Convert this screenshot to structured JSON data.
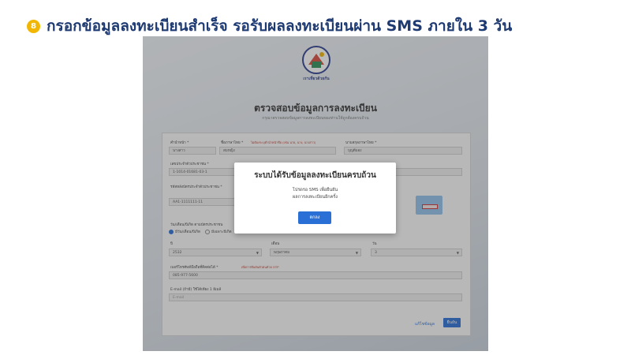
{
  "header": {
    "step_number": "8",
    "title": "กรอกข้อมูลลงทะเบียนสำเร็จ รอรับผลลงทะเบียนผ่าน SMS ภายใน 3 วัน"
  },
  "brand": {
    "logo_text": "เราเที่ยวด้วยกัน"
  },
  "form": {
    "title": "ตรวจสอบข้อมูลการลงทะเบียน",
    "subtitle": "กรุณาตรวจสอบข้อมูลการลงทะเบียนของท่านให้ถูกต้องครบถ้วน",
    "prefix_label": "คำนำหน้า *",
    "prefix_value": "นางสาว",
    "firstname_label": "ชื่อภาษาไทย *",
    "firstname_hint": "ไม่ต้องระบุคำนำหน้าชื่อ (เช่น นาย, นาง, นางสาว)",
    "firstname_value": "สมหญิง",
    "lastname_label": "นามสกุลภาษาไทย *",
    "lastname_value": "บุญดีมอง",
    "idcard_label": "เลขประจำตัวประชาชน *",
    "idcard_value": "1-1014-01681-03-1",
    "laser_label": "รหัสหลังบัตรประจำตัวประชาชน *",
    "laser_value": "AA1-1111111-11",
    "birth_label": "วัน/เดือน/ปีเกิด ตามบัตรประชาชน",
    "birth_option_full": "มีวัน/เดือน/ปีเกิด",
    "birth_option_partial": "มีเฉพาะปีเกิด",
    "year_label": "ปี",
    "year_value": "2532",
    "month_label": "เดือน",
    "month_value": "พฤษภาคม",
    "day_label": "วัน",
    "day_value": "3",
    "phone_label": "เบอร์โทรศัพท์มือถือที่ติดต่อได้ *",
    "phone_hint": "เพื่อการยืนยันตัวตนด้วย OTP",
    "phone_value": "085-977-5600",
    "email_label": "E-mail (ถ้ามี) ใช้ได้เพียง 1 อีเมล์",
    "email_placeholder": "E-mail",
    "back_label": "แก้ไขข้อมูล",
    "confirm_label": "ยืนยัน"
  },
  "modal": {
    "title": "ระบบได้รับข้อมูลลงทะเบียนครบถ้วน",
    "line1": "โปรดรอ SMS เพื่อยืนยัน",
    "line2": "ผลการลงทะเบียนอีกครั้ง",
    "ok_label": "ตกลง"
  },
  "colors": {
    "heading": "#1e3a72",
    "badge": "#f2b705",
    "primary": "#2a6fd6"
  }
}
